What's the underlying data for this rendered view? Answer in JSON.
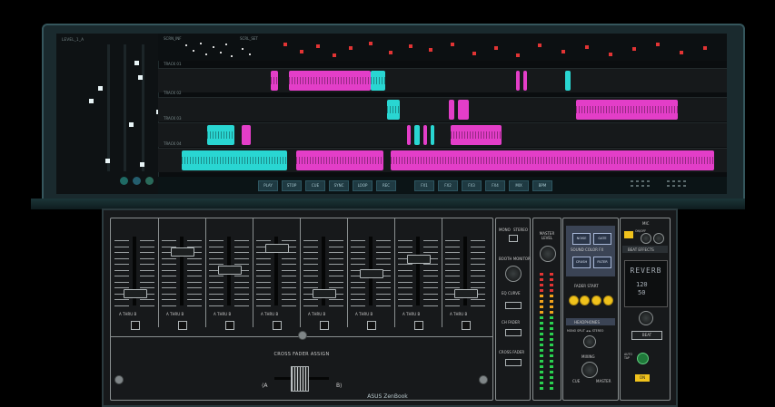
{
  "screen": {
    "left_panel_label": "LEVEL_1_A",
    "top_labels": [
      "SCRN_INF",
      "SCRL_SET"
    ],
    "lanes": [
      {
        "label": "TRACK 01"
      },
      {
        "label": "TRACK 02"
      },
      {
        "label": "TRACK 03"
      },
      {
        "label": "TRACK 04"
      }
    ],
    "transport_buttons": [
      "PLAY",
      "STOP",
      "CUE",
      "SYNC",
      "LOOP",
      "REC",
      "FX1",
      "FX2",
      "FX3",
      "FX4",
      "MIX",
      "BPM"
    ]
  },
  "mixer": {
    "channels": [
      {
        "assign": "A THRU B"
      },
      {
        "assign": "A THRU B"
      },
      {
        "assign": "A THRU B"
      },
      {
        "assign": "A THRU B"
      },
      {
        "assign": "A THRU B"
      },
      {
        "assign": "A THRU B"
      },
      {
        "assign": "A THRU B"
      },
      {
        "assign": "A THRU B"
      }
    ],
    "crossfader_label": "CROSS FADER ASSIGN",
    "cf_left": "⟨A",
    "cf_right": "B⟩"
  },
  "mid_column": {
    "mono": "MONO",
    "stereo": "STEREO",
    "booth_monitor": "BOOTH MONITOR",
    "eq_curve": "EQ CURVE",
    "ch_fader": "CH FADER",
    "cross_fader": "CROSS FADER"
  },
  "master": {
    "label": "MASTER LEVEL"
  },
  "fx": {
    "buttons": [
      "NOISE",
      "GATE",
      "CRUSH",
      "FILTER"
    ],
    "sound_color_fx": "SOUND COLOR FX",
    "fader_start": "FADER START",
    "headphones": "HEADPHONES",
    "mono_split": "MONO SPLIT ◄ ► STEREO",
    "mixing": "MIXING",
    "cue": "CUE",
    "master": "MASTER"
  },
  "beat": {
    "mic": "MIC",
    "on_off": "ON/OFF",
    "beat_effects": "BEAT EFFECTS",
    "display_effect": "REVERB",
    "display_bpm": "120",
    "display_pct": "50",
    "beat_btn": "BEAT",
    "auto_tap": "AUTO TAP",
    "on": "ON"
  },
  "brand": "ASUS ZenBook",
  "colors": {
    "magenta": "#e33ec8",
    "cyan": "#29d6d2",
    "fx_led": "#f0c21c"
  }
}
